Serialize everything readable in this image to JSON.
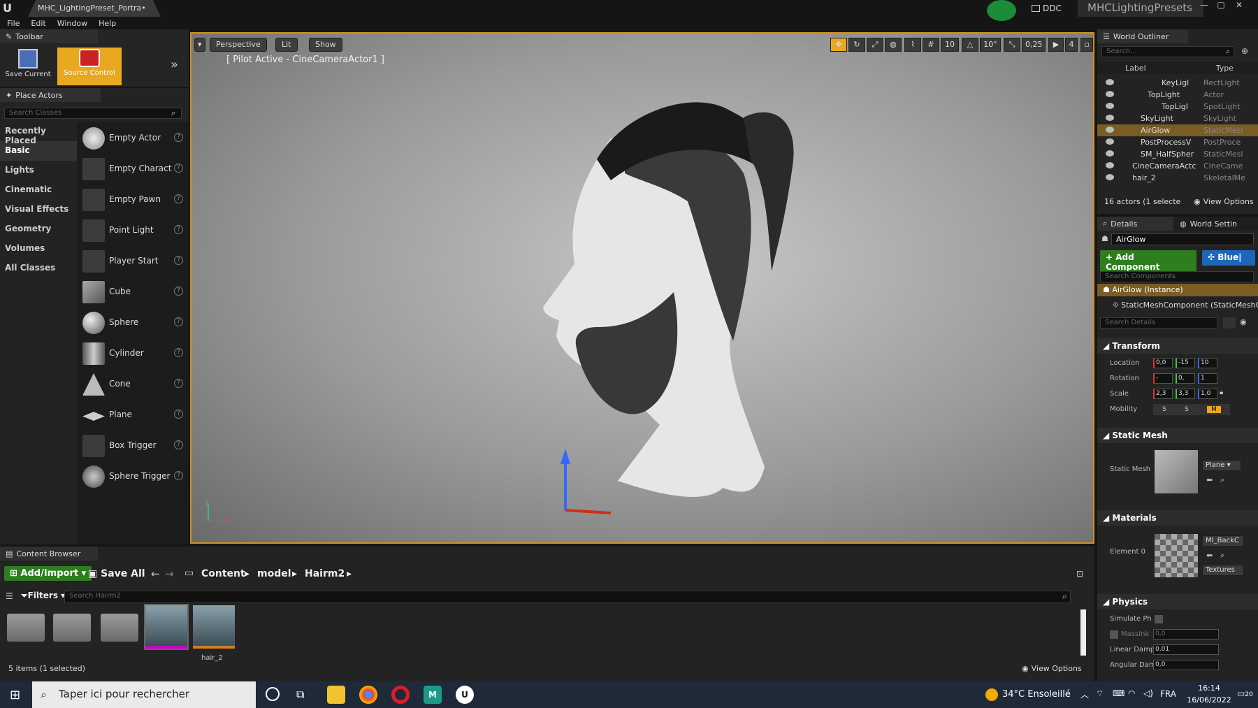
{
  "titlebar": {
    "doc_tab": "MHC_LightingPreset_Portra•",
    "ddc": "DDC",
    "project": "MHCLightingPresets",
    "min": "—",
    "max": "▢",
    "close": "✕"
  },
  "menu": [
    "File",
    "Edit",
    "Window",
    "Help"
  ],
  "toolbar": {
    "tab": "Toolbar",
    "save_current": "Save Current",
    "source_control": "Source Control",
    "more": "»"
  },
  "place_actors": {
    "tab": "Place Actors",
    "search_placeholder": "Search Classes",
    "categories": [
      "Recently Placed",
      "Basic",
      "Lights",
      "Cinematic",
      "Visual Effects",
      "Geometry",
      "Volumes",
      "All Classes"
    ],
    "items": [
      "Empty Actor",
      "Empty Charact",
      "Empty Pawn",
      "Point Light",
      "Player Start",
      "Cube",
      "Sphere",
      "Cylinder",
      "Cone",
      "Plane",
      "Box Trigger",
      "Sphere Trigger"
    ]
  },
  "viewport": {
    "perspective": "Perspective",
    "lit": "Lit",
    "show": "Show",
    "pilot": "[ Pilot Active - CineCameraActor1 ]",
    "grid_snap": "10",
    "rot_snap": "10°",
    "scale_snap": "0,25",
    "cam_speed": "4"
  },
  "outliner": {
    "tab": "World Outliner",
    "search_placeholder": "Search...",
    "col_label": "Label",
    "col_type": "Type",
    "rows": [
      {
        "label": "KeyLigl",
        "type": "RectLight",
        "indent": 92
      },
      {
        "label": "TopLight",
        "type": "Actor",
        "indent": 72
      },
      {
        "label": "TopLigl",
        "type": "SpotLight",
        "indent": 92
      },
      {
        "label": "SkyLight",
        "type": "SkyLight",
        "indent": 62
      },
      {
        "label": "AirGlow",
        "type": "StaticMesl",
        "indent": 62,
        "selected": true
      },
      {
        "label": "PostProcessV",
        "type": "PostProce",
        "indent": 62
      },
      {
        "label": "SM_HalfSpher",
        "type": "StaticMesl",
        "indent": 62
      },
      {
        "label": "CineCameraActc",
        "type": "CineCame",
        "indent": 50
      },
      {
        "label": "hair_2",
        "type": "SkeletalMe",
        "indent": 50
      }
    ],
    "status": "16 actors (1 selecte",
    "view_options": "View Options"
  },
  "details": {
    "tab": "Details",
    "tab2": "World Settin",
    "name": "AirGlow",
    "add_component": "+ Add Component",
    "blueprint": "Blue|",
    "comp_search": "Search Components",
    "instance": "AirGlow (Instance)",
    "component": "StaticMeshComponent (StaticMeshC",
    "details_search": "Search Details",
    "transform": "Transform",
    "location": "Location",
    "rotation": "Rotation",
    "scale": "Scale",
    "mobility": "Mobility",
    "loc": [
      "0,0",
      "-15",
      "10"
    ],
    "rot": [
      "-",
      "0,",
      "1"
    ],
    "scl": [
      "2,3",
      "3,3",
      "1,0"
    ],
    "mobility_opts": [
      "S",
      "S",
      "M"
    ],
    "static_mesh_sec": "Static Mesh",
    "static_mesh_lbl": "Static Mesh",
    "mesh_value": "Plane",
    "materials_sec": "Materials",
    "element0": "Element 0",
    "mat_value": "MI_BackC",
    "textures": "Textures",
    "physics_sec": "Physics",
    "simulate": "Simulate Ph",
    "mass": "MassInk",
    "mass_val": "0,0",
    "linear_damp": "Linear Damp",
    "linear_val": "0,01",
    "angular_damp": "Angular Dam",
    "angular_val": "0,0"
  },
  "content": {
    "tab": "Content Browser",
    "add_import": "Add/Import",
    "save_all": "Save All",
    "path": [
      "Content",
      "model",
      "Hairm2"
    ],
    "filters": "Filters",
    "search_placeholder": "Search Hairm2",
    "asset_label": "hair_2",
    "status": "5 items (1 selected)",
    "view_options": "View Options"
  },
  "taskbar": {
    "search": "Taper ici pour rechercher",
    "weather": "34°C Ensoleillé",
    "lang": "FRA",
    "time": "16:14",
    "date": "16/06/2022",
    "notif": "20"
  }
}
